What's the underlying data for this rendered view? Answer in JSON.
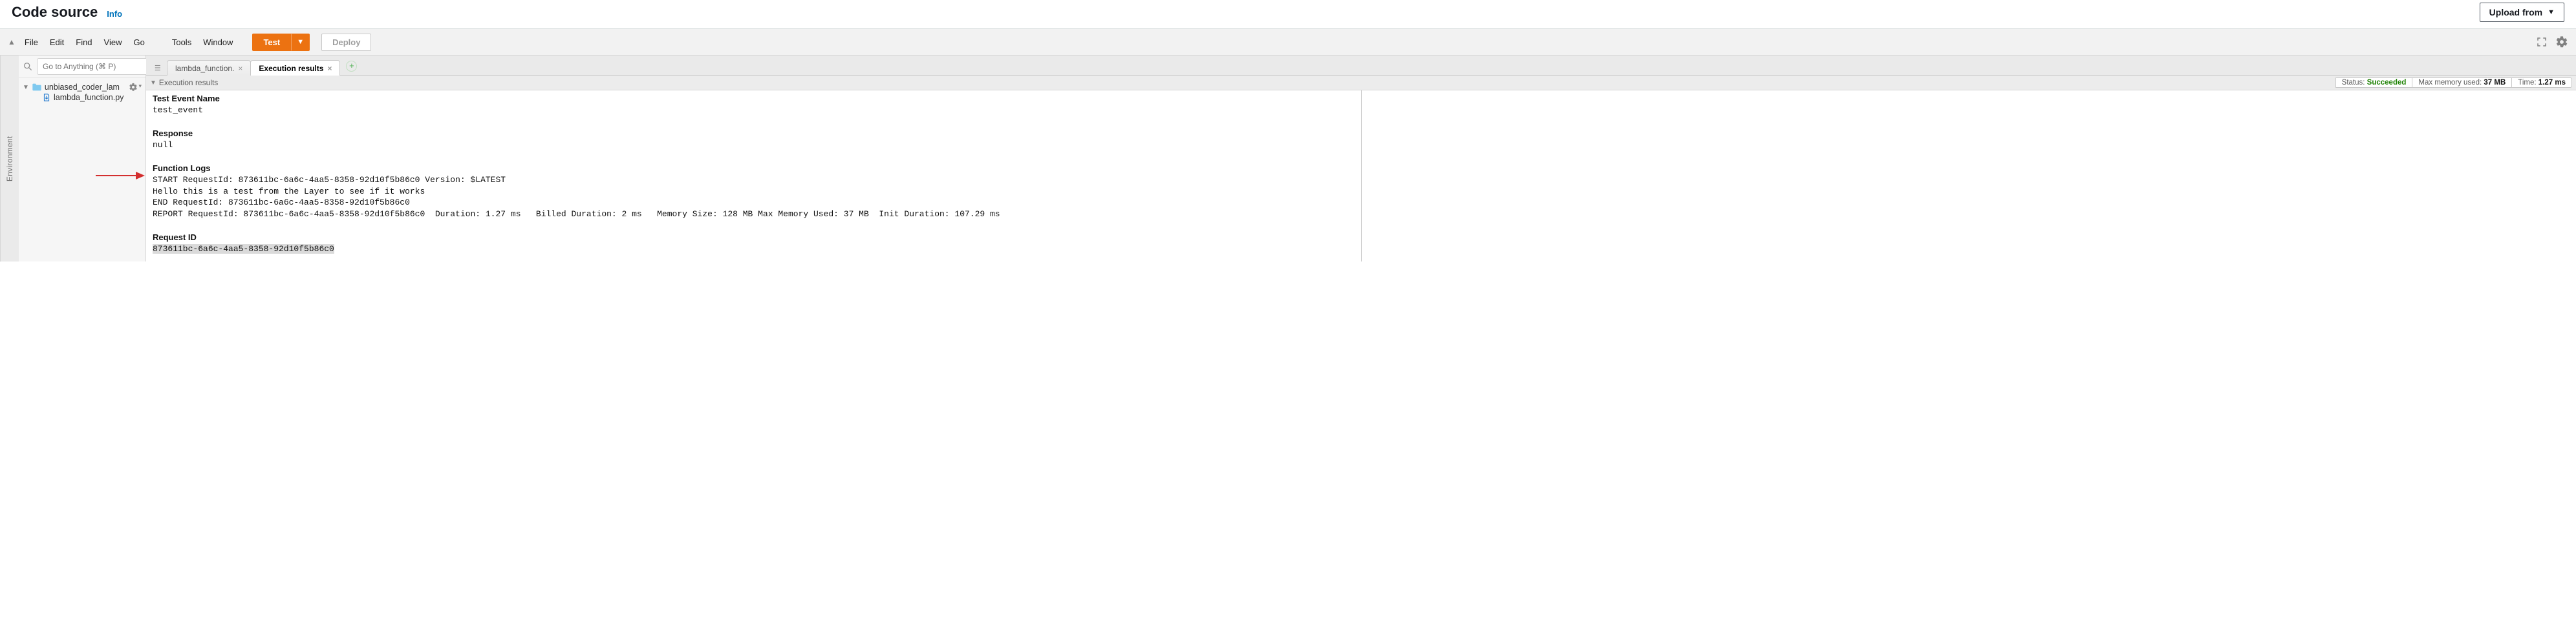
{
  "header": {
    "title": "Code source",
    "info": "Info",
    "upload": "Upload from"
  },
  "menubar": {
    "items": [
      "File",
      "Edit",
      "Find",
      "View",
      "Go",
      "Tools",
      "Window"
    ],
    "test": "Test",
    "deploy": "Deploy"
  },
  "sidebar": {
    "env_rail": "Environment",
    "goto_placeholder": "Go to Anything (⌘ P)",
    "root": "unbiased_coder_lam",
    "file": "lambda_function.py"
  },
  "tabs": {
    "first": "lambda_function.",
    "second": "Execution results"
  },
  "exec": {
    "panel_title": "Execution results",
    "status_label": "Status: ",
    "status_value": "Succeeded",
    "mem_label": "Max memory used: ",
    "mem_value": "37 MB",
    "time_label": "Time: ",
    "time_value": "1.27 ms",
    "test_event_label": "Test Event Name",
    "test_event_value": "test_event",
    "response_label": "Response",
    "response_value": "null",
    "function_logs_label": "Function Logs",
    "log_line1": "START RequestId: 873611bc-6a6c-4aa5-8358-92d10f5b86c0 Version: $LATEST",
    "log_line2": "Hello this is a test from the Layer to see if it works",
    "log_line3": "END RequestId: 873611bc-6a6c-4aa5-8358-92d10f5b86c0",
    "log_line4": "REPORT RequestId: 873611bc-6a6c-4aa5-8358-92d10f5b86c0  Duration: 1.27 ms   Billed Duration: 2 ms   Memory Size: 128 MB Max Memory Used: 37 MB  Init Duration: 107.29 ms",
    "request_id_label": "Request ID",
    "request_id_value": "873611bc-6a6c-4aa5-8358-92d10f5b86c0"
  }
}
